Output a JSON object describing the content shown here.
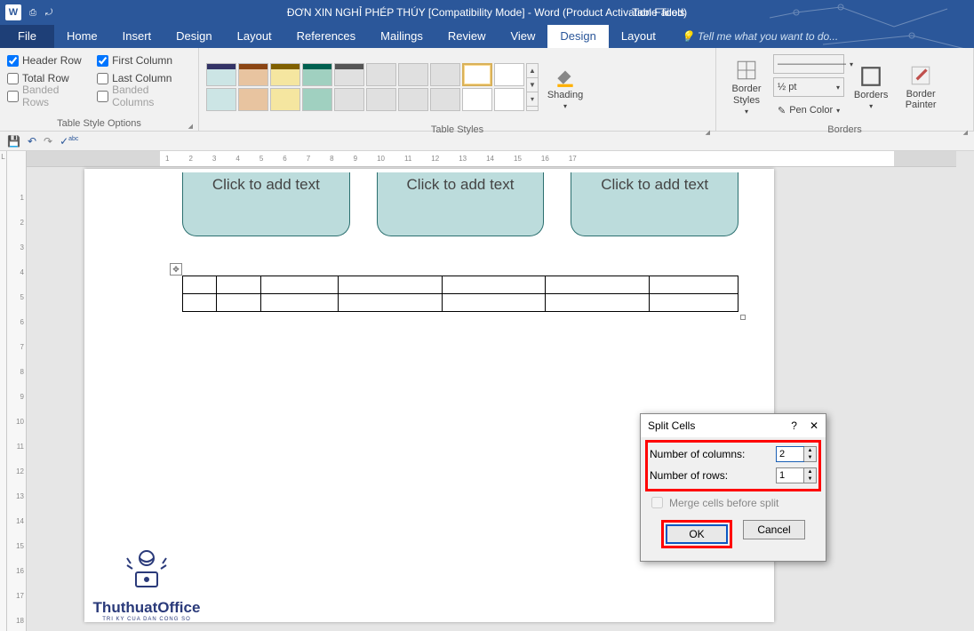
{
  "title": "ĐƠN XIN NGHỈ PHÉP THÚY [Compatibility Mode] - Word (Product Activation Failed)",
  "tableTools": "Table Tools",
  "tabs": {
    "file": "File",
    "home": "Home",
    "insert": "Insert",
    "design": "Design",
    "layout": "Layout",
    "references": "References",
    "mailings": "Mailings",
    "review": "Review",
    "view": "View",
    "tt_design": "Design",
    "tt_layout": "Layout",
    "tell": "Tell me what you want to do..."
  },
  "options": {
    "headerRow": "Header Row",
    "firstCol": "First Column",
    "totalRow": "Total Row",
    "lastCol": "Last Column",
    "bandedRows": "Banded Rows",
    "bandedCols": "Banded Columns",
    "group": "Table Style Options"
  },
  "styles": {
    "group": "Table Styles",
    "shading": "Shading"
  },
  "borders": {
    "lineStyles": "———————",
    "weight": "½ pt",
    "penColor": "Pen Color",
    "borderStyles": "Border Styles",
    "borders": "Borders",
    "borderPainter": "Border Painter",
    "group": "Borders"
  },
  "doc": {
    "placeholder": "Click to add text"
  },
  "dialog": {
    "title": "Split Cells",
    "numCols": "Number of columns:",
    "numRows": "Number of rows:",
    "colsVal": "2",
    "rowsVal": "1",
    "merge": "Merge cells before split",
    "ok": "OK",
    "cancel": "Cancel"
  },
  "watermark": {
    "brand": "ThuthuatOffice",
    "tag": "TRI KY CUA DAN CONG SO"
  }
}
